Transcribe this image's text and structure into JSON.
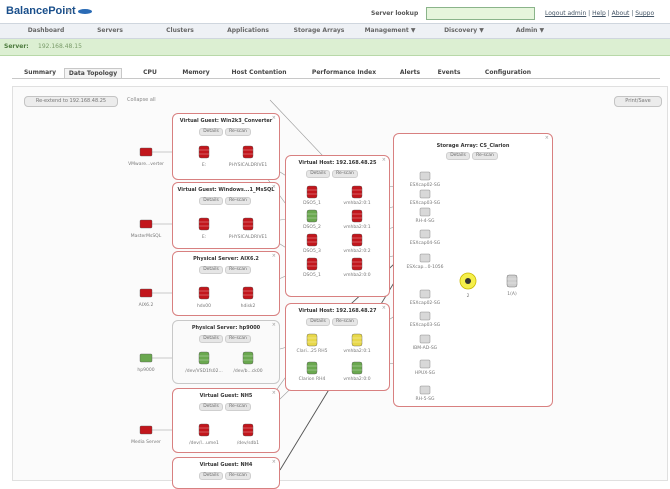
{
  "header": {
    "logo_text": "BalancePoint",
    "logo_sub": "by",
    "server_lookup_label": "Server lookup",
    "links": [
      "Logout admin",
      "Help",
      "About",
      "Suppo"
    ]
  },
  "nav": [
    "Dashboard",
    "Servers",
    "Clusters",
    "Applications",
    "Storage Arrays",
    "Management ▼",
    "Discovery ▼",
    "Admin ▼"
  ],
  "server_bar": {
    "label": "Server:",
    "value": "192.168.48.15"
  },
  "tabs": [
    "Summary",
    "Data Topology",
    "CPU",
    "Memory",
    "Host Contention",
    "Performance Index",
    "Alerts",
    "Events",
    "Configuration"
  ],
  "active_tab": "Data Topology",
  "toolbar": {
    "reextend": "Re-extend to 192.168.48.25",
    "collapse": "Collapse all",
    "print": "Print/Save"
  },
  "guests": [
    {
      "title": "Virtual Guest: Win2k3_Converter",
      "details": "Details",
      "rescan": "Re-scan",
      "left": "E:",
      "right": "PHYSICALDRIVE1",
      "src": "VMware...verter"
    },
    {
      "title": "Virtual Guest: Windows...1_MsSQL",
      "details": "Details",
      "rescan": "Re-scan",
      "left": "E:",
      "right": "PHYSICALDRIVE1",
      "src": "MasterMsSQL"
    },
    {
      "title": "Physical Server: AIX6.2",
      "details": "Details",
      "rescan": "Re-scan",
      "left": "hdx00",
      "right": "hdisk2",
      "src": "AIX6.2"
    },
    {
      "title": "Physical Server: hp9000",
      "details": "Details",
      "rescan": "Re-scan",
      "left": "/dev/VSD1fs02...",
      "right": "/dev/b...ck00",
      "src": "hp9000"
    },
    {
      "title": "Virtual Guest: NH5",
      "details": "Details",
      "rescan": "Re-scan",
      "left": "/dev/l...ume1",
      "right": "/dev/sdb1",
      "src": "Media Server"
    },
    {
      "title": "Virtual Guest: NH4",
      "details": "Details",
      "rescan": "Re-scan"
    }
  ],
  "hosts": [
    {
      "title": "Virtual Host: 192.168.48.25",
      "details": "Details",
      "rescan": "Re-scan",
      "rows": [
        [
          "DSO5_1",
          "vmhba2:0:1"
        ],
        [
          "DSO5_2",
          "vmhba2:0:1"
        ],
        [
          "DSO5_3",
          "vmhba2:0:2"
        ],
        [
          "DSO5_1",
          "vmhba2:0:0"
        ]
      ]
    },
    {
      "title": "Virtual Host: 192.168.48.27",
      "details": "Details",
      "rescan": "Re-scan",
      "rows": [
        [
          "Clari...25 RH5",
          "vmhba2:0:1"
        ],
        [
          "Clarion RH4",
          "vmhba2:0:0"
        ]
      ]
    }
  ],
  "array": {
    "title": "Storage Array: CS_Clarion",
    "details": "Details",
    "rescan": "Re-scan",
    "luns": [
      "ESXcap02-SG",
      "ESXcap03-SG",
      "RH-4-SG",
      "ESXcap04-SG",
      "ESXcap...0-1056",
      "ESXcap02-SG",
      "ESXcap03-SG",
      "IBM-AD-SG",
      "HPUX-SG",
      "RH-5-SG"
    ],
    "hub": "2",
    "port": "1(A)"
  },
  "colors": {
    "red": "#c2161c",
    "green": "#6aa84f",
    "yellow": "#e8d84a",
    "box_border": "#d88080"
  }
}
